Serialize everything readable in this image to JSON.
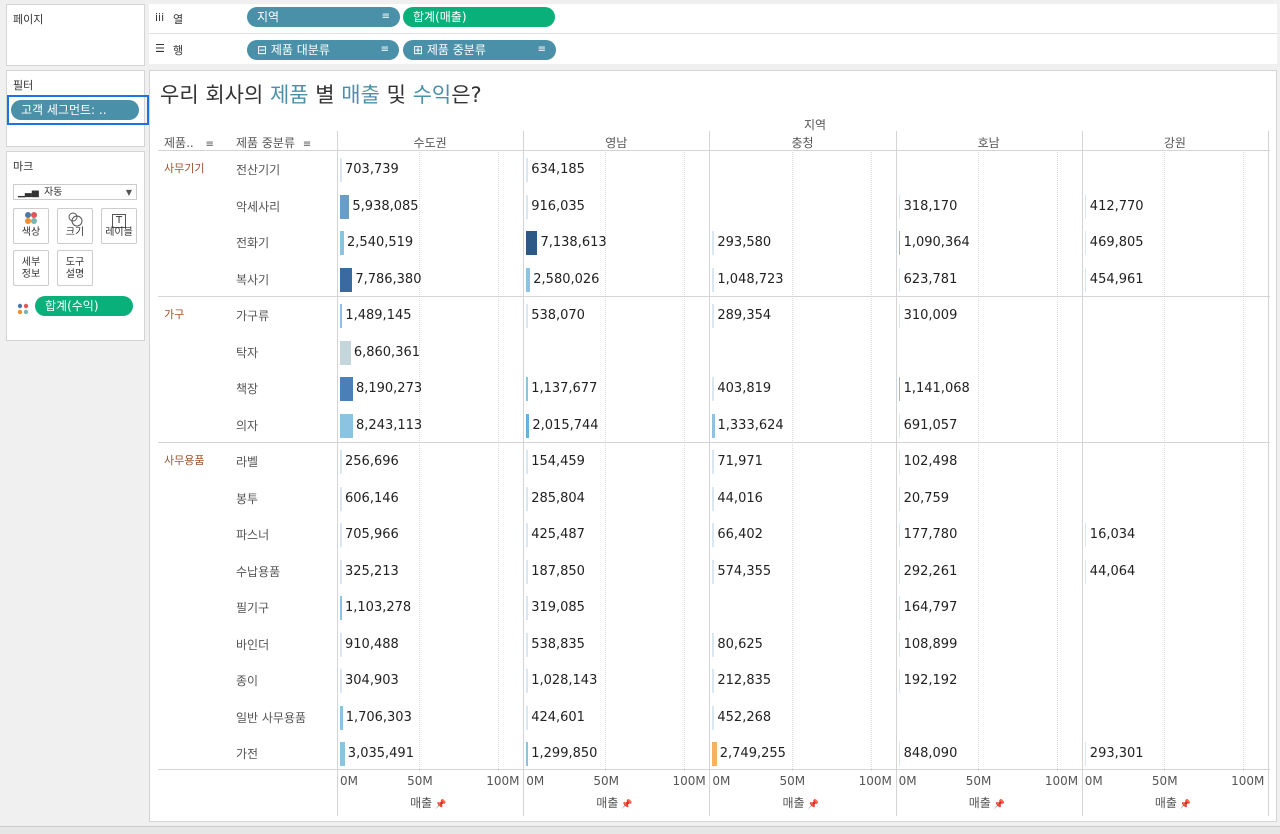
{
  "shelves": {
    "pages_title": "페이지",
    "columns_label": "열",
    "rows_label": "행",
    "columns_pills": [
      "지역",
      "합계(매출)"
    ],
    "rows_pills": [
      "⊟ 제품 대분류",
      "⊞ 제품 중분류"
    ]
  },
  "filters": {
    "title": "필터",
    "pill": "고객 세그먼트: .."
  },
  "marks": {
    "title": "마크",
    "type": "자동",
    "buttons": [
      {
        "label": "색상",
        "icon": "color-icon"
      },
      {
        "label": "크기",
        "icon": "size-icon"
      },
      {
        "label": "레이블",
        "icon": "label-icon"
      },
      {
        "label": "세부\n정보",
        "icon": "detail-icon"
      },
      {
        "label": "도구\n설명",
        "icon": "tooltip-icon"
      }
    ],
    "field_pill": "합계(수익)"
  },
  "viz": {
    "title_parts": [
      {
        "text": "우리 회사의 ",
        "color": "#333333"
      },
      {
        "text": "제품",
        "color": "#4a90a8"
      },
      {
        "text": " 별 ",
        "color": "#333333"
      },
      {
        "text": "매출",
        "color": "#4a90a8"
      },
      {
        "text": " 및 ",
        "color": "#333333"
      },
      {
        "text": "수익",
        "color": "#4a90a8"
      },
      {
        "text": "은?",
        "color": "#333333"
      }
    ],
    "column_header_group": "지역",
    "row_header_labels": [
      "제품..",
      "제품 중분류"
    ],
    "axis_label": "매출",
    "axis_ticks": [
      "0M",
      "50M",
      "100M"
    ]
  },
  "chart_data": {
    "type": "table",
    "columns": [
      "수도권",
      "영남",
      "충청",
      "호남",
      "강원"
    ],
    "axis_max": 100000000,
    "groups": [
      {
        "name": "사무기기",
        "rows": [
          {
            "name": "전산기기",
            "values": [
              703739,
              634185,
              null,
              null,
              null
            ],
            "colors": [
              "#d9e7f0",
              "#d9e7f0",
              null,
              null,
              null
            ]
          },
          {
            "name": "악세사리",
            "values": [
              5938085,
              916035,
              null,
              318170,
              412770
            ],
            "colors": [
              "#6a9ec8",
              "#d9e7f0",
              null,
              "#d9e7f0",
              "#d9e7f0"
            ]
          },
          {
            "name": "전화기",
            "values": [
              2540519,
              7138613,
              293580,
              1090364,
              469805
            ],
            "colors": [
              "#8cc2e2",
              "#2c5a85",
              "#d9e7f0",
              "#8cc2e2",
              "#d9e7f0"
            ]
          },
          {
            "name": "복사기",
            "values": [
              7786380,
              2580026,
              1048723,
              623781,
              454961
            ],
            "colors": [
              "#3a6aa0",
              "#8cc2e2",
              "#d9e7f0",
              "#d9e7f0",
              "#d9e7f0"
            ]
          }
        ]
      },
      {
        "name": "가구",
        "rows": [
          {
            "name": "가구류",
            "values": [
              1489145,
              538070,
              289354,
              310009,
              null
            ],
            "colors": [
              "#8cc2e2",
              "#d9e7f0",
              "#d9e7f0",
              "#d9e7f0",
              null
            ]
          },
          {
            "name": "탁자",
            "values": [
              6860361,
              null,
              null,
              null,
              null
            ],
            "colors": [
              "#c5d5dc",
              null,
              null,
              null,
              null
            ]
          },
          {
            "name": "책장",
            "values": [
              8190273,
              1137677,
              403819,
              1141068,
              null
            ],
            "colors": [
              "#4a7fb8",
              "#8cc2e2",
              "#d9e7f0",
              "#8cc2e2",
              null
            ]
          },
          {
            "name": "의자",
            "values": [
              8243113,
              2015744,
              1333624,
              691057,
              null
            ],
            "colors": [
              "#8cc2e2",
              "#6ab0dc",
              "#8cc2e2",
              "#d9e7f0",
              null
            ]
          }
        ]
      },
      {
        "name": "사무용품",
        "rows": [
          {
            "name": "라벨",
            "values": [
              256696,
              154459,
              71971,
              102498,
              null
            ],
            "colors": [
              "#d9e7f0",
              "#d9e7f0",
              "#d9e7f0",
              "#d9e7f0",
              null
            ]
          },
          {
            "name": "봉투",
            "values": [
              606146,
              285804,
              44016,
              20759,
              null
            ],
            "colors": [
              "#d9e7f0",
              "#d9e7f0",
              "#d9e7f0",
              "#d9e7f0",
              null
            ]
          },
          {
            "name": "파스너",
            "values": [
              705966,
              425487,
              66402,
              177780,
              16034
            ],
            "colors": [
              "#d9e7f0",
              "#d9e7f0",
              "#d9e7f0",
              "#d9e7f0",
              "#d9e7f0"
            ]
          },
          {
            "name": "수납용품",
            "values": [
              325213,
              187850,
              574355,
              292261,
              44064
            ],
            "colors": [
              "#d9e7f0",
              "#d9e7f0",
              "#d9e7f0",
              "#d9e7f0",
              "#d9e7f0"
            ]
          },
          {
            "name": "필기구",
            "values": [
              1103278,
              319085,
              null,
              164797,
              null
            ],
            "colors": [
              "#8cc2e2",
              "#d9e7f0",
              null,
              "#d9e7f0",
              null
            ]
          },
          {
            "name": "바인더",
            "values": [
              910488,
              538835,
              80625,
              108899,
              null
            ],
            "colors": [
              "#d9e7f0",
              "#d9e7f0",
              "#d9e7f0",
              "#d9e7f0",
              null
            ]
          },
          {
            "name": "종이",
            "values": [
              304903,
              1028143,
              212835,
              192192,
              null
            ],
            "colors": [
              "#d9e7f0",
              "#d9e7f0",
              "#d9e7f0",
              "#d9e7f0",
              null
            ]
          },
          {
            "name": "일반 사무용품",
            "values": [
              1706303,
              424601,
              452268,
              null,
              null
            ],
            "colors": [
              "#8cc2e2",
              "#d9e7f0",
              "#d9e7f0",
              null,
              null
            ]
          },
          {
            "name": "가전",
            "values": [
              3035491,
              1299850,
              2749255,
              848090,
              293301
            ],
            "colors": [
              "#8cc2e2",
              "#8cc2e2",
              "#f5b060",
              "#d9e7f0",
              "#d9e7f0"
            ]
          }
        ]
      }
    ]
  }
}
